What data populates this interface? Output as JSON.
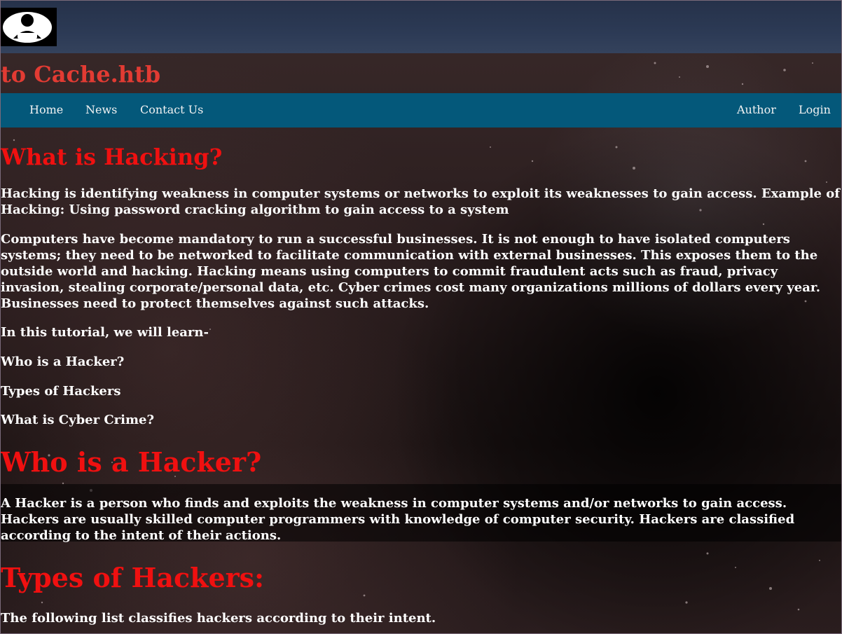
{
  "header": {
    "site_title": "to Cache.htb",
    "logo_icon": "hacker-logo-icon"
  },
  "nav": {
    "left": [
      "Home",
      "News",
      "Contact Us"
    ],
    "right": [
      "Author",
      "Login"
    ]
  },
  "colors": {
    "nav_bg": "#04587a",
    "heading_red": "#f01010",
    "title_red": "#e23b33",
    "topbar": "#2c3a55"
  },
  "content": {
    "h1": "What is Hacking?",
    "p1": "Hacking is identifying weakness in computer systems or networks to exploit its weaknesses to gain access. Example of Hacking: Using password cracking algorithm to gain access to a system",
    "p2": "Computers have become mandatory to run a successful businesses. It is not enough to have isolated computers systems; they need to be networked to facilitate communication with external businesses. This exposes them to the outside world and hacking. Hacking means using computers to commit fraudulent acts such as fraud, privacy invasion, stealing corporate/personal data, etc. Cyber crimes cost many organizations millions of dollars every year. Businesses need to protect themselves against such attacks.",
    "p3": "In this tutorial, we will learn-",
    "list": [
      "Who is a Hacker?",
      "Types of Hackers",
      "What is Cyber Crime?"
    ],
    "h2": "Who is a Hacker?",
    "p4": "A Hacker is a person who finds and exploits the weakness in computer systems and/or networks to gain access. Hackers are usually skilled computer programmers with knowledge of computer security. Hackers are classified according to the intent of their actions.",
    "h3": "Types of Hackers:",
    "p5": "The following list classifies hackers according to their intent."
  }
}
